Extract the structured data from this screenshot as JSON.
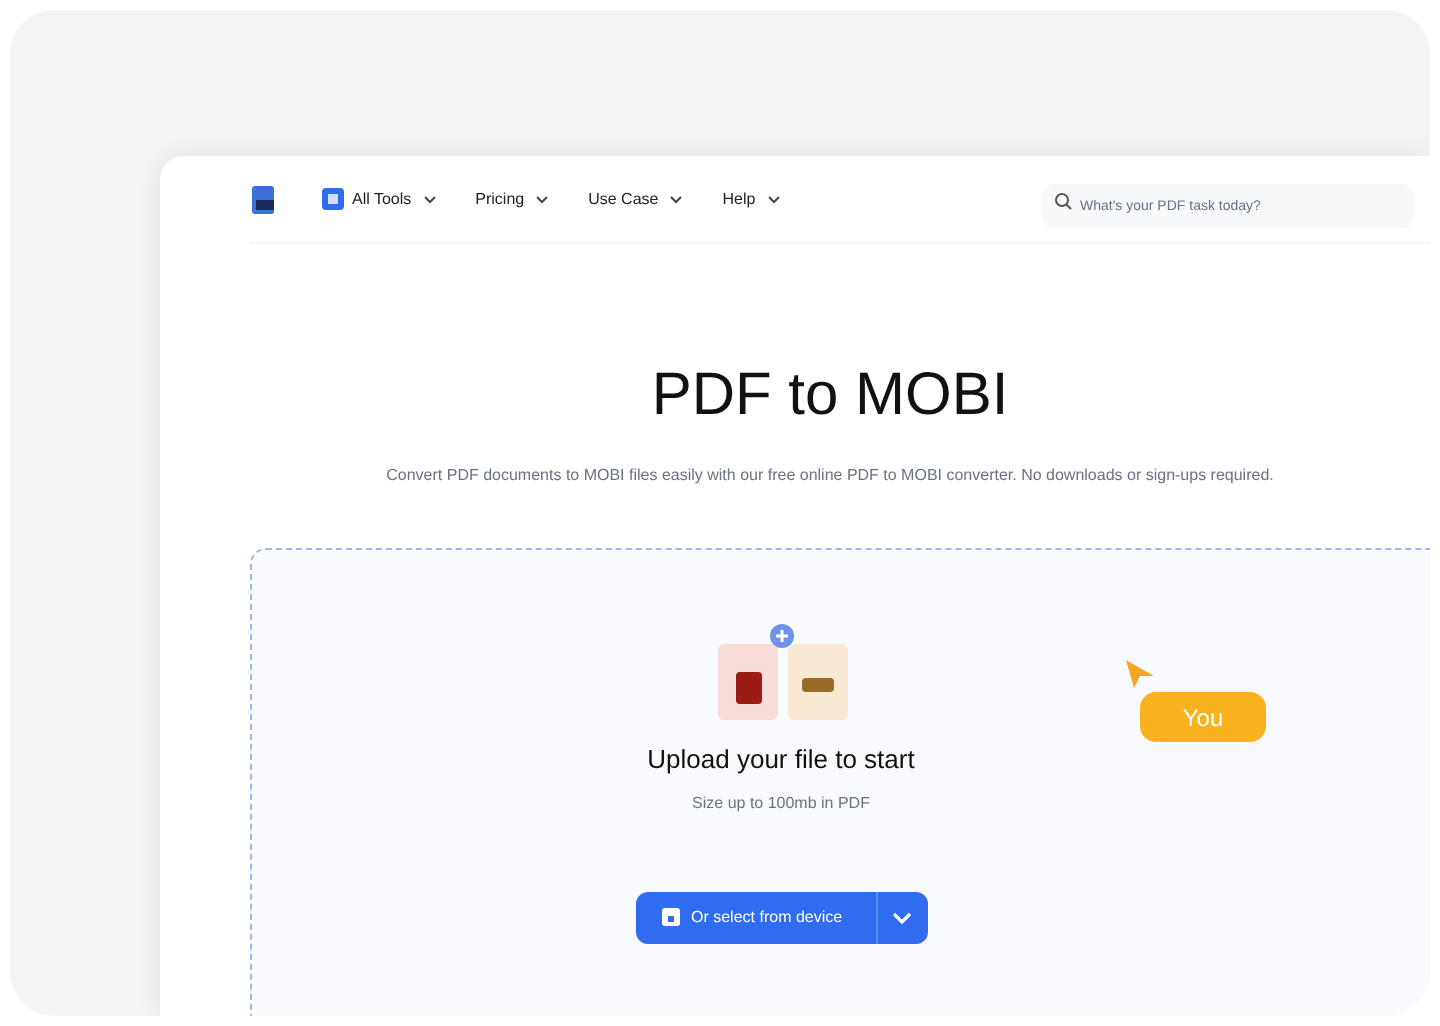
{
  "nav": {
    "items": [
      {
        "label": "All Tools",
        "kind": "tools"
      },
      {
        "label": "Pricing",
        "kind": "menu"
      },
      {
        "label": "Use Case",
        "kind": "menu"
      },
      {
        "label": "Help",
        "kind": "menu"
      }
    ],
    "search": {
      "placeholder": "What's your PDF task today?"
    }
  },
  "hero": {
    "title": "PDF to MOBI",
    "subtitle": "Convert PDF documents to MOBI files easily with our free online PDF to MOBI converter. No downloads or sign-ups required."
  },
  "upload": {
    "title": "Upload your file to start",
    "hint": "Size up to 100mb in PDF",
    "cursor_label": "You",
    "button": "Or select from device"
  }
}
